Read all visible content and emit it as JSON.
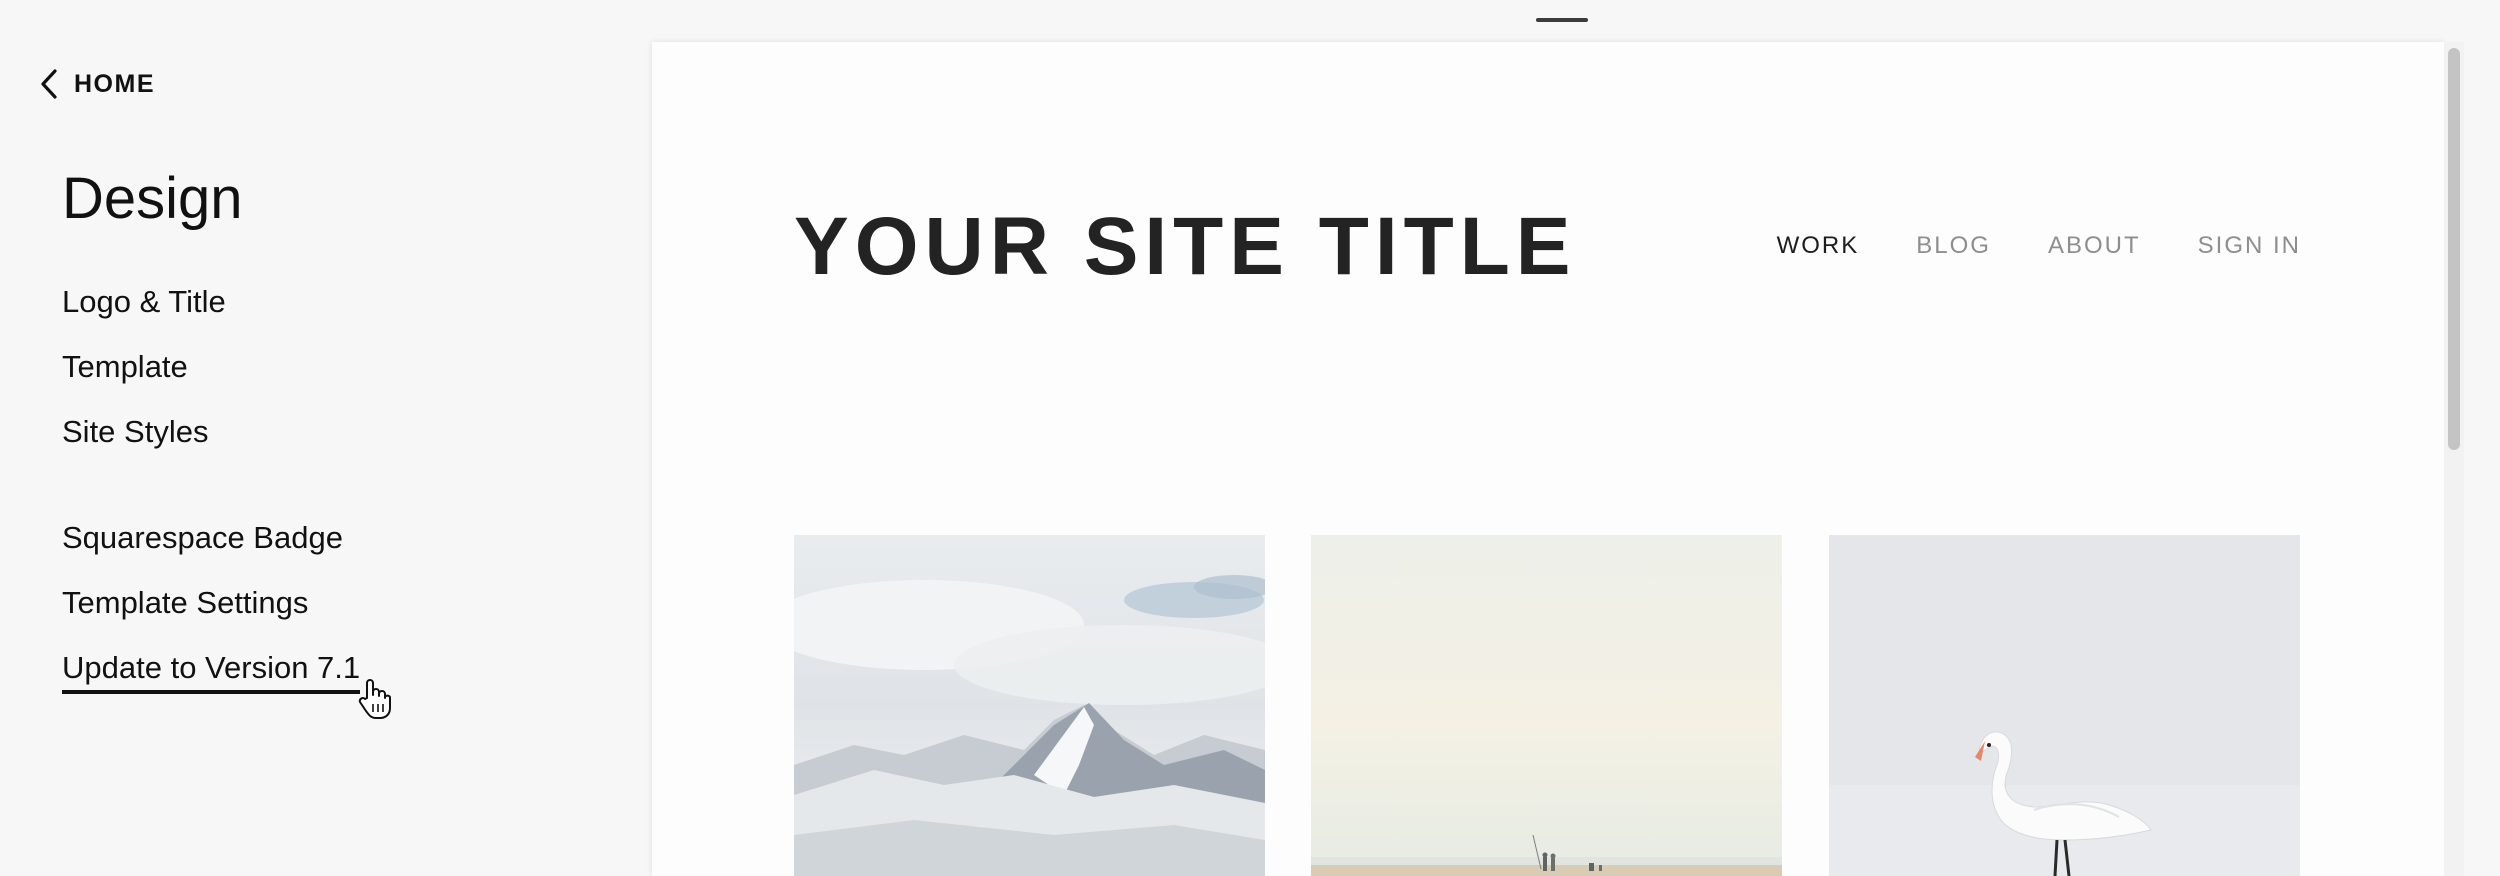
{
  "sidebar": {
    "back_label": "HOME",
    "title": "Design",
    "items": [
      {
        "label": "Logo & Title"
      },
      {
        "label": "Template"
      },
      {
        "label": "Site Styles"
      },
      {
        "label": "Squarespace Badge"
      },
      {
        "label": "Template Settings"
      },
      {
        "label": "Update to Version 7.1"
      }
    ]
  },
  "preview": {
    "site_title": "YOUR SITE TITLE",
    "nav": [
      {
        "label": "WORK"
      },
      {
        "label": "BLOG"
      },
      {
        "label": "ABOUT"
      },
      {
        "label": "SIGN IN"
      }
    ],
    "gallery": [
      {
        "subject": "snowy-mountains"
      },
      {
        "subject": "people-on-beach"
      },
      {
        "subject": "white-swan"
      }
    ]
  },
  "colors": {
    "panel_bg": "#f7f7f7",
    "preview_bg": "#fdfdfd",
    "text": "#111111",
    "nav_inactive": "#8e8e8e"
  }
}
